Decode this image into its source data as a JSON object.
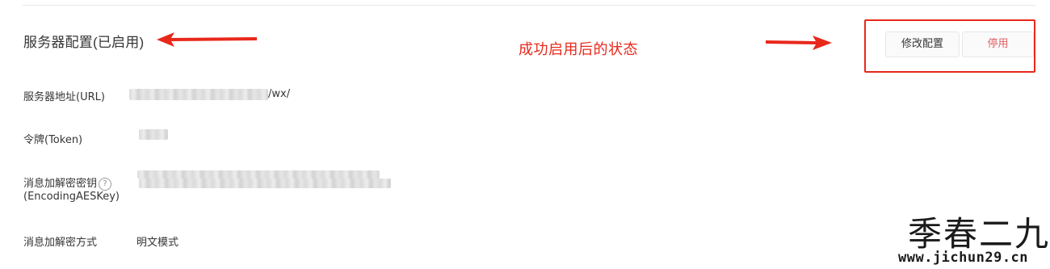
{
  "config_section": {
    "title": "服务器配置(已启用)",
    "annotation": "成功启用后的状态",
    "buttons": {
      "edit_label": "修改配置",
      "stop_label": "停用"
    }
  },
  "fields": {
    "server_url": {
      "label": "服务器地址(URL)",
      "value_suffix": "/wx/"
    },
    "token": {
      "label": "令牌(Token)"
    },
    "aes_key": {
      "label_line1": "消息加解密密钥",
      "help_glyph": "?",
      "label_line2": "(EncodingAESKey)"
    },
    "encrypt_mode": {
      "label": "消息加解密方式",
      "value": "明文模式"
    }
  },
  "watermark": {
    "brand": "季春二九",
    "url": "www.jichun29.cn"
  },
  "colors": {
    "annotation_red": "#e8281b",
    "stop_button_text": "#e15f63",
    "text": "#353535"
  }
}
